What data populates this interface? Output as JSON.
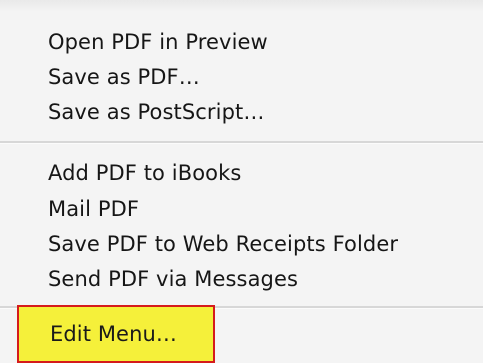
{
  "menu": {
    "group1": [
      {
        "label": "Open PDF in Preview"
      },
      {
        "label": "Save as PDF…"
      },
      {
        "label": "Save as PostScript…"
      }
    ],
    "group2": [
      {
        "label": "Add PDF to iBooks"
      },
      {
        "label": "Mail PDF"
      },
      {
        "label": "Save PDF to Web Receipts Folder"
      },
      {
        "label": "Send PDF via Messages"
      }
    ],
    "edit_item": {
      "label": "Edit Menu…",
      "highlight_fill": "#f5f03a",
      "highlight_border": "#d51b1b"
    }
  }
}
